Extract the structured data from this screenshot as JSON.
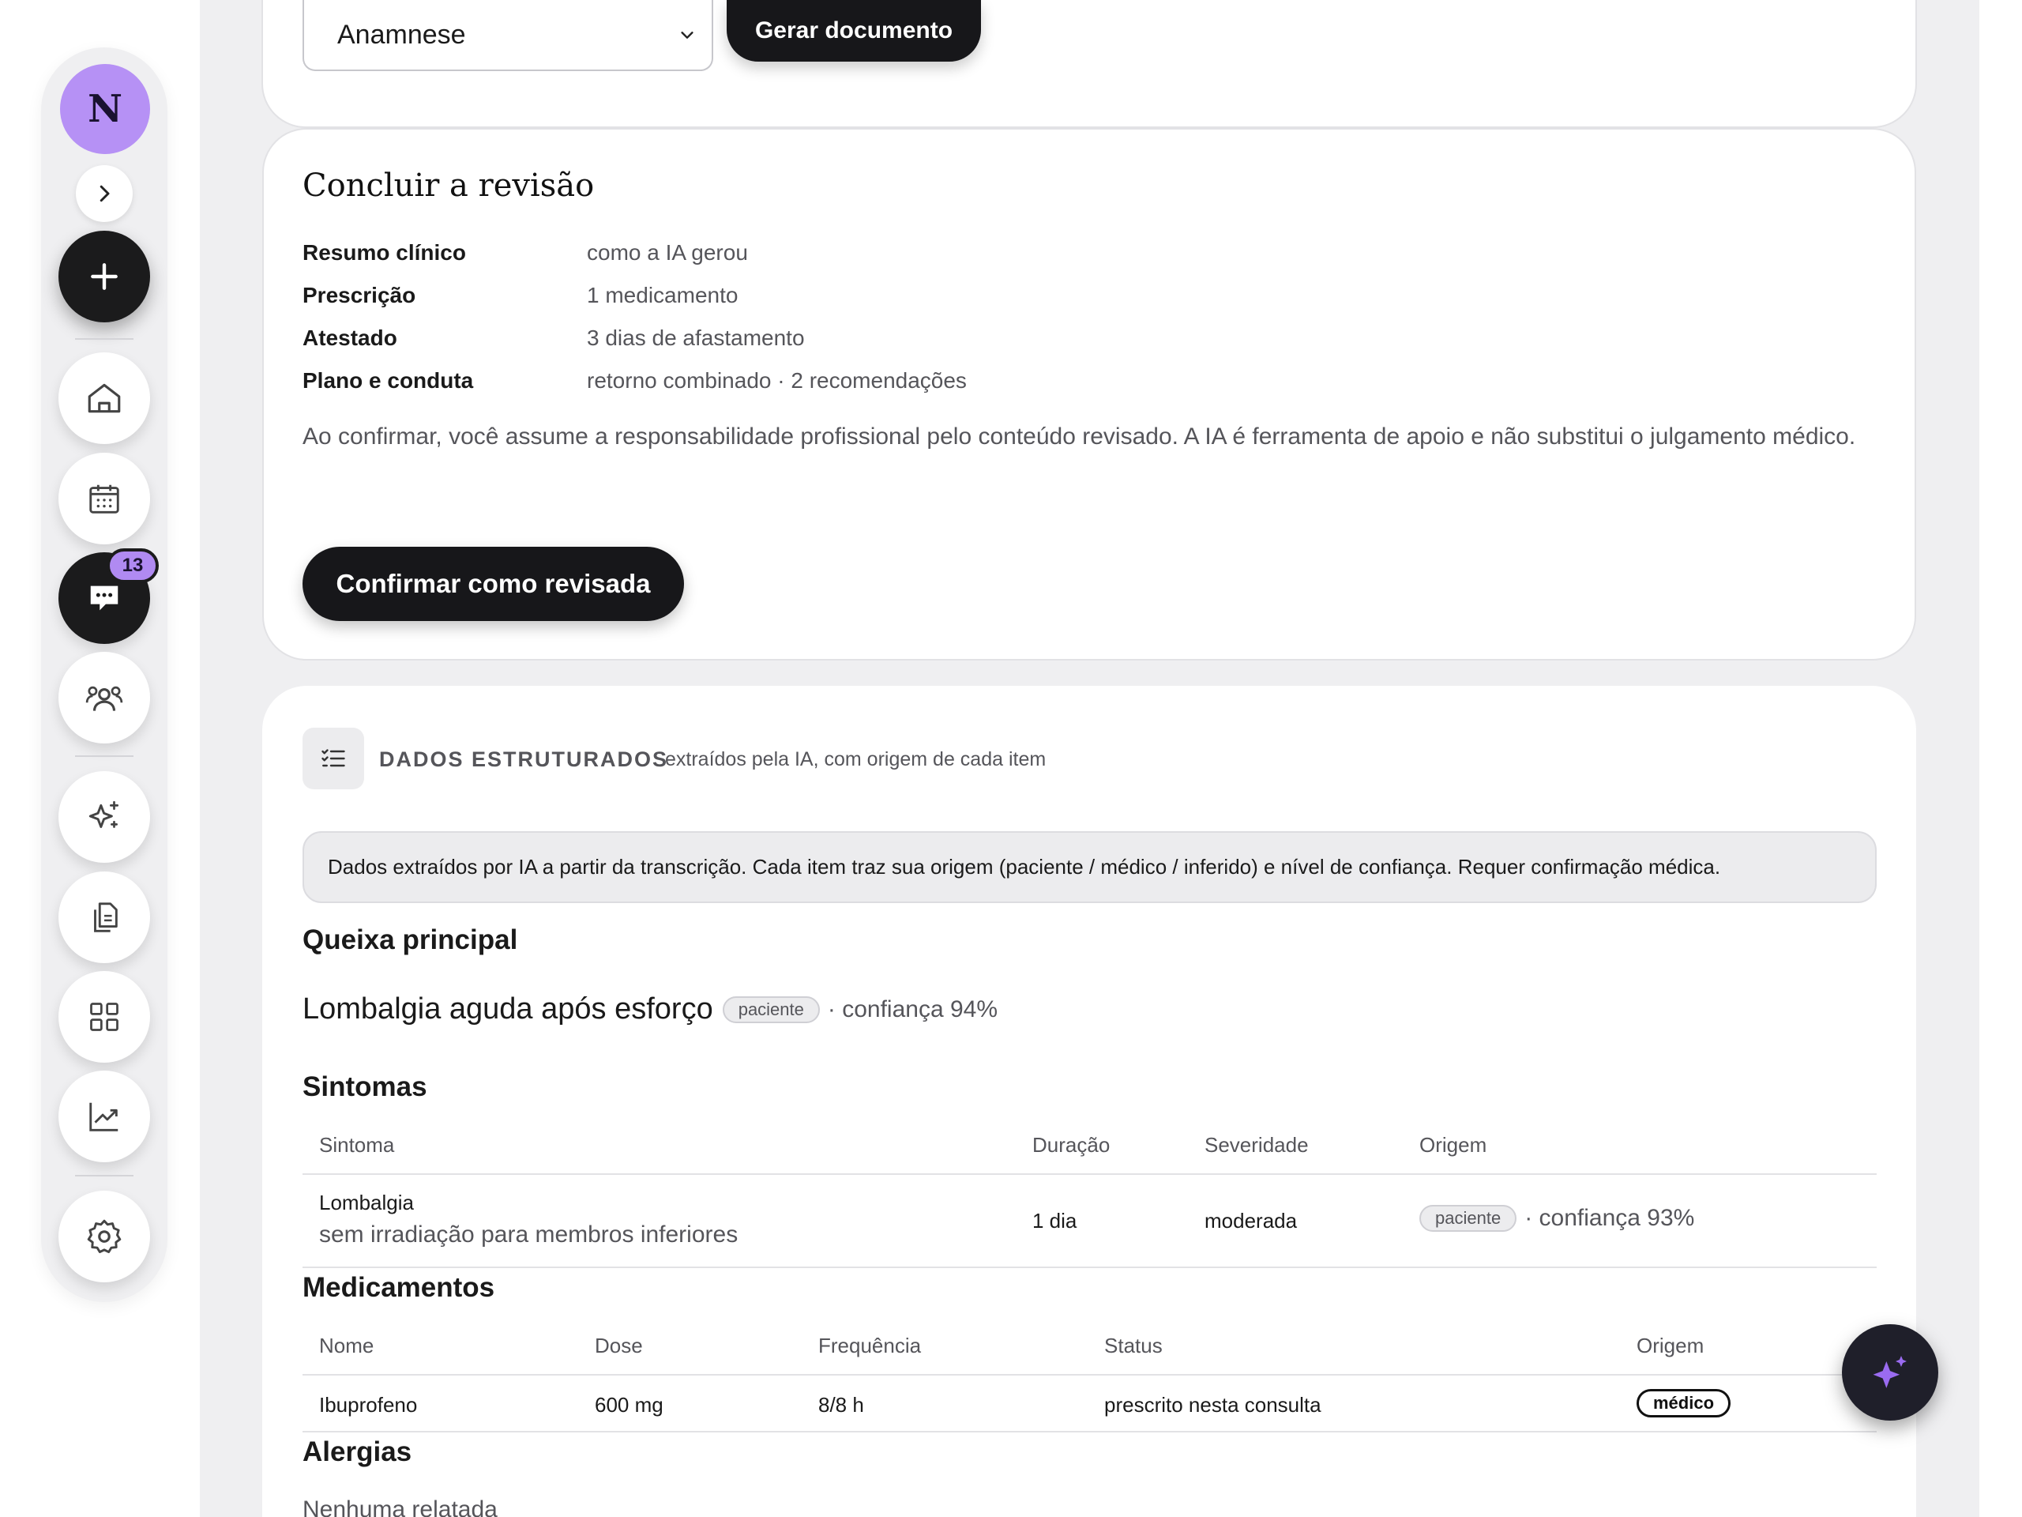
{
  "sidebar": {
    "avatar_initial": "N",
    "messages_badge": "13",
    "items": [
      "home-icon",
      "calendar-icon",
      "chat-icon",
      "people-icon",
      "sparkle-icon",
      "documents-icon",
      "grid-icon",
      "chart-icon",
      "gear-icon"
    ]
  },
  "top": {
    "select_value": "Anamnese",
    "generate_label": "Gerar documento"
  },
  "review": {
    "title": "Concluir a revisão",
    "rows": [
      {
        "label": "Resumo clínico",
        "value": "como a IA gerou"
      },
      {
        "label": "Prescrição",
        "value": "1 medicamento"
      },
      {
        "label": "Atestado",
        "value": "3 dias de afastamento"
      },
      {
        "label": "Plano e conduta",
        "value": "retorno combinado · 2 recomendações"
      }
    ],
    "disclaimer": "Ao confirmar, você assume a responsabilidade profissional pelo conteúdo revisado. A IA é ferramenta de apoio e não substitui o julgamento médico.",
    "confirm_label": "Confirmar como revisada"
  },
  "data": {
    "section_title": "DADOS ESTRUTURADOS",
    "section_subtitle": "extraídos pela IA, com origem de cada item",
    "info": "Dados extraídos por IA a partir da transcrição. Cada item traz sua origem (paciente / médico / inferido) e nível de confiança. Requer confirmação médica.",
    "complaint_heading": "Queixa principal",
    "complaint": {
      "text": "Lombalgia aguda após esforço",
      "origin": "paciente",
      "confidence": "· confiança 94%"
    },
    "symptoms_heading": "Sintomas",
    "symptoms_headers": [
      "Sintoma",
      "Duração",
      "Severidade",
      "Origem"
    ],
    "symptoms": [
      {
        "name": "Lombalgia",
        "detail": "sem irradiação para membros inferiores",
        "duration": "1 dia",
        "severity": "moderada",
        "origin": "paciente",
        "confidence": "· confiança 93%"
      }
    ],
    "meds_heading": "Medicamentos",
    "meds_headers": [
      "Nome",
      "Dose",
      "Frequência",
      "Status",
      "Origem"
    ],
    "meds": [
      {
        "name": "Ibuprofeno",
        "dose": "600 mg",
        "frequency": "8/8 h",
        "status": "prescrito nesta consulta",
        "origin": "médico"
      }
    ],
    "allergies_heading": "Alergias",
    "allergies_value": "Nenhuma relatada"
  },
  "fab_icon": "ai-sparkle-icon"
}
